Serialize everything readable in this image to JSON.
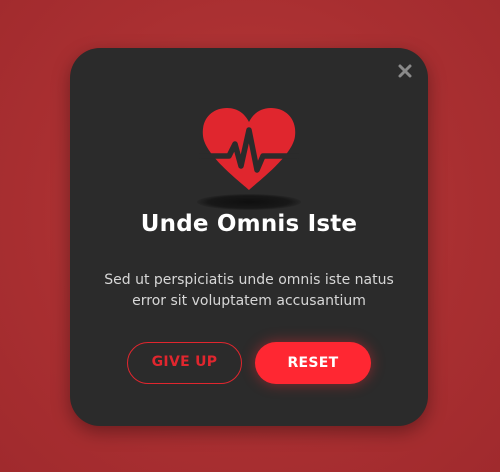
{
  "dialog": {
    "title": "Unde Omnis Iste",
    "description": "Sed ut perspiciatis unde omnis iste natus error sit voluptatem accusantium",
    "close_icon": "close-icon",
    "hero_icon": "heart-pulse-icon"
  },
  "actions": {
    "give_up_label": "GIVE UP",
    "reset_label": "RESET"
  },
  "colors": {
    "background": "#a92f31",
    "dialog_background": "#2b2b2b",
    "accent": "#ff2732",
    "heart": "#e0262e"
  }
}
